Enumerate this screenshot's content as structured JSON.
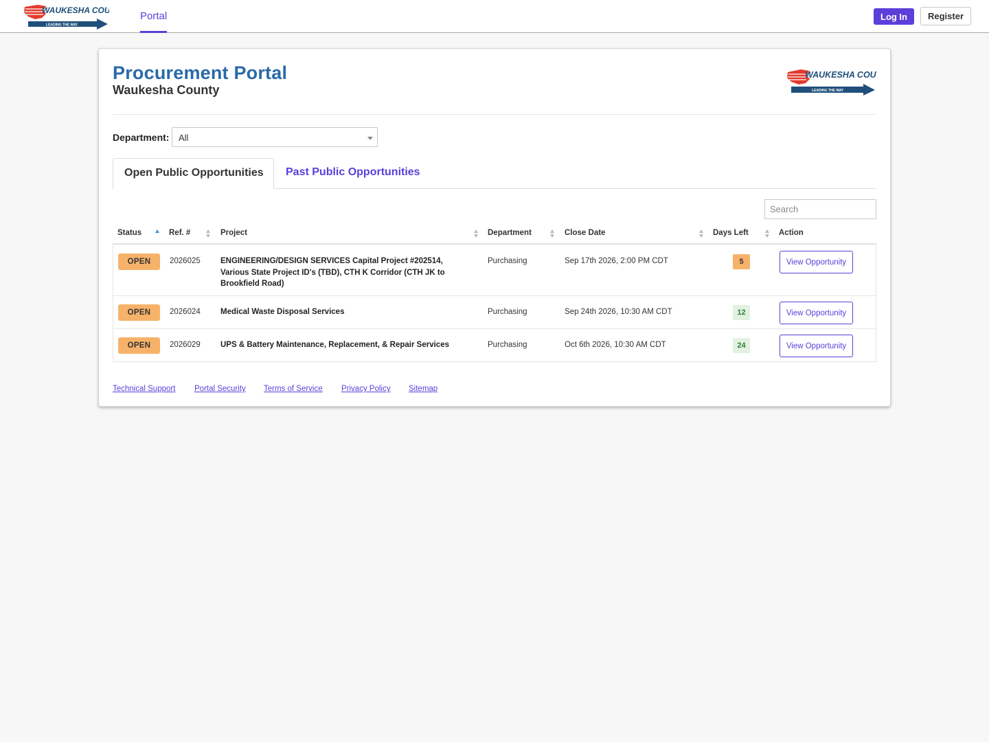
{
  "header": {
    "logo_text": "WAUKESHA COUNTY",
    "logo_tagline": "LEADING THE WAY",
    "nav_active": "Portal",
    "login_label": "Log In",
    "register_label": "Register",
    "accent_color": "#5b3fd9"
  },
  "page": {
    "title": "Procurement Portal",
    "subtitle": "Waukesha County",
    "title_color": "#2a6aa8"
  },
  "filter": {
    "department_label": "Department:",
    "department_value": "All"
  },
  "tabs": [
    {
      "label": "Open Public Opportunities",
      "active": true
    },
    {
      "label": "Past Public Opportunities",
      "active": false
    }
  ],
  "search": {
    "placeholder": "Search"
  },
  "table": {
    "columns": [
      "Status",
      "Ref. #",
      "Project",
      "Department",
      "Close Date",
      "Days Left",
      "Action"
    ],
    "sorted_by": "Status",
    "sort_direction": "ascending",
    "rows": [
      {
        "status": "OPEN",
        "ref": "2026025",
        "project": "ENGINEERING/DESIGN SERVICES Capital Project #202514, Various State Project ID's (TBD), CTH K Corridor (CTH JK to Brookfield Road)",
        "department": "Purchasing",
        "close_date": "Sep 17th 2026, 2:00 PM CDT",
        "days_left": "5",
        "action": "View Opportunity"
      },
      {
        "status": "OPEN",
        "ref": "2026024",
        "project": "Medical Waste Disposal Services",
        "department": "Purchasing",
        "close_date": "Sep 24th 2026, 10:30 AM CDT",
        "days_left": "12",
        "action": "View Opportunity"
      },
      {
        "status": "OPEN",
        "ref": "2026029",
        "project": "UPS & Battery Maintenance, Replacement, & Repair Services",
        "department": "Purchasing",
        "close_date": "Oct 6th 2026, 10:30 AM CDT",
        "days_left": "24",
        "action": "View Opportunity"
      }
    ]
  },
  "footer": {
    "links": [
      "Technical Support",
      "Portal Security",
      "Terms of Service",
      "Privacy Policy",
      "Sitemap"
    ]
  }
}
